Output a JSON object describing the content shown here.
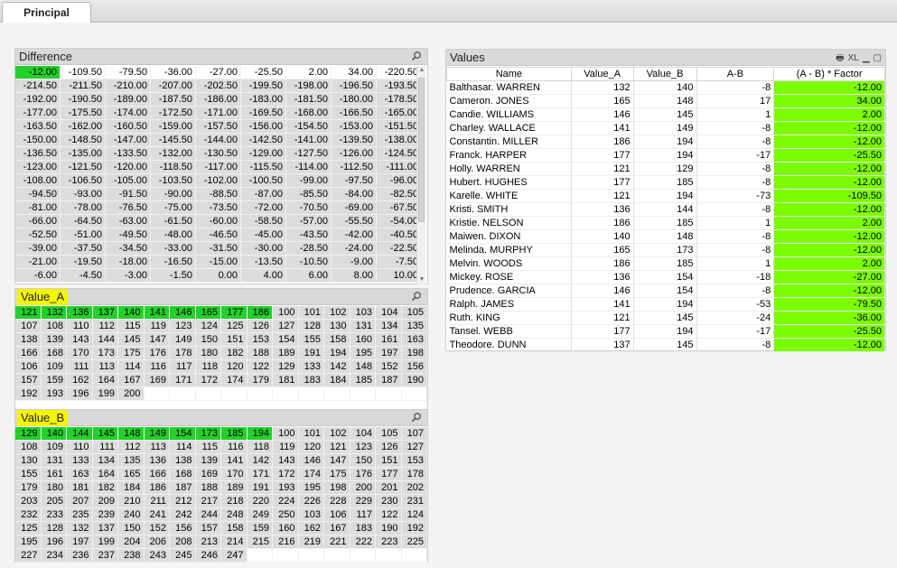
{
  "tab": {
    "label": "Principal"
  },
  "difference": {
    "title": "Difference",
    "selected": [
      "-12.00"
    ],
    "available": [
      "-109.50",
      "-79.50",
      "-36.00",
      "-27.00",
      "-25.50",
      "2.00",
      "34.00",
      "-220.50"
    ],
    "excluded": [
      "-214.50",
      "-211.50",
      "-210.00",
      "-207.00",
      "-202.50",
      "-199.50",
      "-198.00",
      "-196.50",
      "-193.50",
      "-192.00",
      "-190.50",
      "-189.00",
      "-187.50",
      "-186.00",
      "-183.00",
      "-181.50",
      "-180.00",
      "-178.50",
      "-177.00",
      "-175.50",
      "-174.00",
      "-172.50",
      "-171.00",
      "-169.50",
      "-168.00",
      "-166.50",
      "-165.00",
      "-163.50",
      "-162.00",
      "-160.50",
      "-159.00",
      "-157.50",
      "-156.00",
      "-154.50",
      "-153.00",
      "-151.50",
      "-150.00",
      "-148.50",
      "-147.00",
      "-145.50",
      "-144.00",
      "-142.50",
      "-141.00",
      "-139.50",
      "-138.00",
      "-136.50",
      "-135.00",
      "-133.50",
      "-132.00",
      "-130.50",
      "-129.00",
      "-127.50",
      "-126.00",
      "-124.50",
      "-123.00",
      "-121.50",
      "-120.00",
      "-118.50",
      "-117.00",
      "-115.50",
      "-114.00",
      "-112.50",
      "-111.00",
      "-108.00",
      "-106.50",
      "-105.00",
      "-103.50",
      "-102.00",
      "-100.50",
      "-99.00",
      "-97.50",
      "-96.00",
      "-94.50",
      "-93.00",
      "-91.50",
      "-90.00",
      "-88.50",
      "-87.00",
      "-85.50",
      "-84.00",
      "-82.50",
      "-81.00",
      "-78.00",
      "-76.50",
      "-75.00",
      "-73.50",
      "-72.00",
      "-70.50",
      "-69.00",
      "-67.50",
      "-66.00",
      "-64.50",
      "-63.00",
      "-61.50",
      "-60.00",
      "-58.50",
      "-57.00",
      "-55.50",
      "-54.00",
      "-52.50",
      "-51.00",
      "-49.50",
      "-48.00",
      "-46.50",
      "-45.00",
      "-43.50",
      "-42.00",
      "-40.50",
      "-39.00",
      "-37.50",
      "-34.50",
      "-33.00",
      "-31.50",
      "-30.00",
      "-28.50",
      "-24.00",
      "-22.50",
      "-21.00",
      "-19.50",
      "-18.00",
      "-16.50",
      "-15.00",
      "-13.50",
      "-10.50",
      "-9.00",
      "-7.50",
      "-6.00",
      "-4.50",
      "-3.00",
      "-1.50",
      "0.00",
      "4.00",
      "6.00",
      "8.00",
      "10.00"
    ]
  },
  "value_a": {
    "title": "Value_A",
    "selected": [
      "121",
      "132",
      "136",
      "137",
      "140",
      "141",
      "146",
      "165",
      "177",
      "186"
    ],
    "available": [],
    "excluded": [
      "100",
      "101",
      "102",
      "103",
      "104",
      "105",
      "107",
      "108",
      "110",
      "112",
      "115",
      "119",
      "123",
      "124",
      "125",
      "126",
      "127",
      "128",
      "130",
      "131",
      "134",
      "135",
      "138",
      "139",
      "143",
      "144",
      "145",
      "147",
      "149",
      "150",
      "151",
      "153",
      "154",
      "155",
      "158",
      "160",
      "161",
      "163",
      "166",
      "168",
      "170",
      "173",
      "175",
      "176",
      "178",
      "180",
      "182",
      "188",
      "189",
      "191",
      "194",
      "195",
      "197",
      "198",
      "106",
      "109",
      "111",
      "113",
      "114",
      "116",
      "117",
      "118",
      "120",
      "122",
      "129",
      "133",
      "142",
      "148",
      "152",
      "156",
      "157",
      "159",
      "162",
      "164",
      "167",
      "169",
      "171",
      "172",
      "174",
      "179",
      "181",
      "183",
      "184",
      "185",
      "187",
      "190",
      "192",
      "193",
      "196",
      "199",
      "200"
    ]
  },
  "value_b": {
    "title": "Value_B",
    "selected": [
      "129",
      "140",
      "144",
      "145",
      "148",
      "149",
      "154",
      "173",
      "185",
      "194"
    ],
    "available": [],
    "excluded": [
      "100",
      "101",
      "102",
      "104",
      "105",
      "107",
      "108",
      "109",
      "110",
      "111",
      "112",
      "113",
      "114",
      "115",
      "116",
      "118",
      "119",
      "120",
      "121",
      "123",
      "126",
      "127",
      "130",
      "131",
      "133",
      "134",
      "135",
      "136",
      "138",
      "139",
      "141",
      "142",
      "143",
      "146",
      "147",
      "150",
      "151",
      "153",
      "155",
      "161",
      "163",
      "164",
      "165",
      "166",
      "168",
      "169",
      "170",
      "171",
      "172",
      "174",
      "175",
      "176",
      "177",
      "178",
      "179",
      "180",
      "181",
      "182",
      "184",
      "186",
      "187",
      "188",
      "189",
      "191",
      "193",
      "195",
      "198",
      "200",
      "201",
      "202",
      "203",
      "205",
      "207",
      "209",
      "210",
      "211",
      "212",
      "217",
      "218",
      "220",
      "224",
      "226",
      "228",
      "229",
      "230",
      "231",
      "232",
      "233",
      "235",
      "239",
      "240",
      "241",
      "242",
      "244",
      "248",
      "249",
      "250",
      "103",
      "106",
      "117",
      "122",
      "124",
      "125",
      "128",
      "132",
      "137",
      "150",
      "152",
      "156",
      "157",
      "158",
      "159",
      "160",
      "162",
      "167",
      "183",
      "190",
      "192",
      "195",
      "196",
      "197",
      "199",
      "204",
      "206",
      "208",
      "213",
      "214",
      "215",
      "216",
      "219",
      "221",
      "222",
      "223",
      "225",
      "227",
      "234",
      "236",
      "237",
      "238",
      "243",
      "245",
      "246",
      "247"
    ]
  },
  "values": {
    "title": "Values",
    "icons": [
      "print-icon",
      "xl-export-icon",
      "minimize-icon",
      "maximize-icon"
    ],
    "xl_label": "XL",
    "columns": [
      "Name",
      "Value_A",
      "Value_B",
      "A-B",
      "(A - B) * Factor"
    ],
    "rows": [
      [
        "Balthasar. WARREN",
        "132",
        "140",
        "-8",
        "-12.00"
      ],
      [
        "Cameron. JONES",
        "165",
        "148",
        "17",
        "34.00"
      ],
      [
        "Candie. WILLIAMS",
        "146",
        "145",
        "1",
        "2.00"
      ],
      [
        "Charley. WALLACE",
        "141",
        "149",
        "-8",
        "-12.00"
      ],
      [
        "Constantin. MILLER",
        "186",
        "194",
        "-8",
        "-12.00"
      ],
      [
        "Franck. HARPER",
        "177",
        "194",
        "-17",
        "-25.50"
      ],
      [
        "Holly. WARREN",
        "121",
        "129",
        "-8",
        "-12.00"
      ],
      [
        "Hubert. HUGHES",
        "177",
        "185",
        "-8",
        "-12.00"
      ],
      [
        "Karelle. WHITE",
        "121",
        "194",
        "-73",
        "-109.50"
      ],
      [
        "Kristi. SMITH",
        "136",
        "144",
        "-8",
        "-12.00"
      ],
      [
        "Kristie. NELSON",
        "186",
        "185",
        "1",
        "2.00"
      ],
      [
        "Maiwen. DIXON",
        "140",
        "148",
        "-8",
        "-12.00"
      ],
      [
        "Melinda. MURPHY",
        "165",
        "173",
        "-8",
        "-12.00"
      ],
      [
        "Melvin. WOODS",
        "186",
        "185",
        "1",
        "2.00"
      ],
      [
        "Mickey. ROSE",
        "136",
        "154",
        "-18",
        "-27.00"
      ],
      [
        "Prudence. GARCIA",
        "146",
        "154",
        "-8",
        "-12.00"
      ],
      [
        "Ralph. JAMES",
        "141",
        "194",
        "-53",
        "-79.50"
      ],
      [
        "Ruth. KING",
        "121",
        "145",
        "-24",
        "-36.00"
      ],
      [
        "Tansel. WEBB",
        "177",
        "194",
        "-17",
        "-25.50"
      ],
      [
        "Theodore. DUNN",
        "137",
        "145",
        "-8",
        "-12.00"
      ]
    ]
  },
  "colors": {
    "selected": "#22d12a",
    "factor_col": "#7cfc00",
    "excluded": "#dcdcdc",
    "caption_highlight": "#f5f500"
  }
}
